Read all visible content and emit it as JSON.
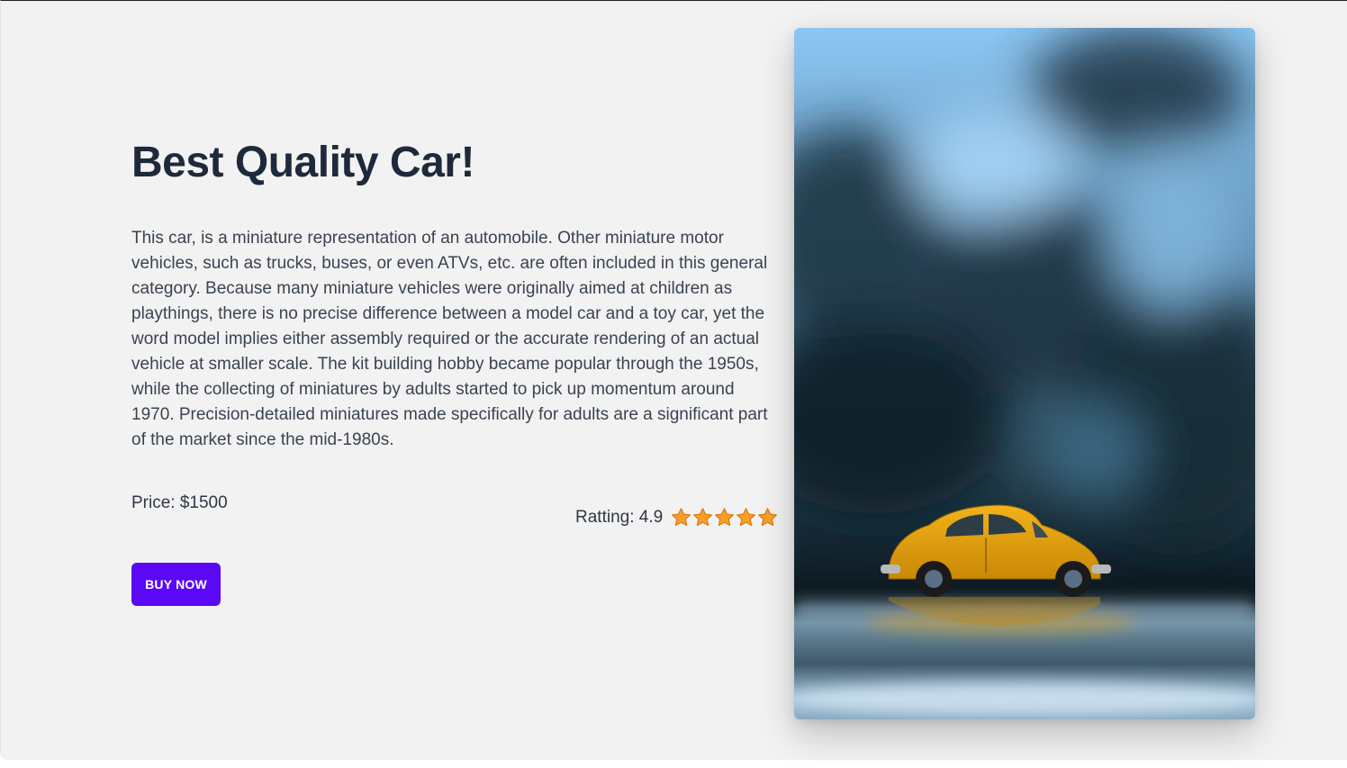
{
  "product": {
    "title": "Best Quality Car!",
    "description": "This car, is a miniature representation of an automobile. Other miniature motor vehicles, such as trucks, buses, or even ATVs, etc. are often included in this general category. Because many miniature vehicles were originally aimed at children as playthings, there is no precise difference between a model car and a toy car, yet the word model implies either assembly required or the accurate rendering of an actual vehicle at smaller scale. The kit building hobby became popular through the 1950s, while the collecting of miniatures by adults started to pick up momentum around 1970. Precision-detailed miniatures made specifically for adults are a significant part of the market since the mid-1980s.",
    "price_label": "Price: $1500",
    "rating_label": "Ratting: 4.9",
    "rating_value": 4.9,
    "stars_count": 5,
    "buy_button_label": "BUY NOW",
    "image_icon": "yellow-toy-car-photo"
  },
  "colors": {
    "background": "#f2f2f2",
    "title": "#1e2a3b",
    "text": "#3a4352",
    "button": "#5b08f5",
    "button_text": "#ffffff",
    "star": "#f7a02b",
    "star_outline": "#d9770f"
  }
}
